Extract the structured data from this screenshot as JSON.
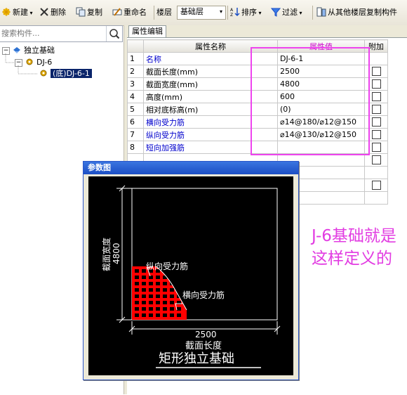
{
  "toolbar": {
    "new_label": "新建",
    "delete_label": "删除",
    "copy_label": "复制",
    "rename_label": "重命名",
    "floor_label": "楼层",
    "floor_value": "基础层",
    "sort_label": "排序",
    "filter_label": "过滤",
    "copy_from_floor_label": "从其他楼层复制构件"
  },
  "search": {
    "placeholder": "搜索构件..."
  },
  "tree": {
    "root": "独立基础",
    "child": "DJ-6",
    "grandchild": "(底)DJ-6-1"
  },
  "properties": {
    "tab": "属性编辑",
    "headers": {
      "name": "属性名称",
      "value": "属性值",
      "add": "附加"
    },
    "rows": [
      {
        "num": "1",
        "name": "名称",
        "value": "DJ-6-1"
      },
      {
        "num": "2",
        "name": "截面长度(mm)",
        "value": "2500"
      },
      {
        "num": "3",
        "name": "截面宽度(mm)",
        "value": "4800"
      },
      {
        "num": "4",
        "name": "高度(mm)",
        "value": "600"
      },
      {
        "num": "5",
        "name": "相对底标高(m)",
        "value": "(0)"
      },
      {
        "num": "6",
        "name": "横向受力筋",
        "value": "⌀14@180/⌀12@150"
      },
      {
        "num": "7",
        "name": "纵向受力筋",
        "value": "⌀14@130/⌀12@150"
      },
      {
        "num": "8",
        "name": "短向加强筋",
        "value": ""
      }
    ]
  },
  "param_window": {
    "title": "参数图",
    "width_label": "截面宽度",
    "width_value": "4800",
    "longitudinal_label": "纵向受力筋",
    "transverse_label": "横向受力筋",
    "length_value": "2500",
    "length_label": "截面长度",
    "caption": "矩形独立基础"
  },
  "annotation": {
    "text": "J-6基础就是这样定义的"
  },
  "colors": {
    "highlight": "#ee44ee",
    "annotation": "#e23ce2",
    "rebar": "#ff0000",
    "link": "#0000cc"
  }
}
